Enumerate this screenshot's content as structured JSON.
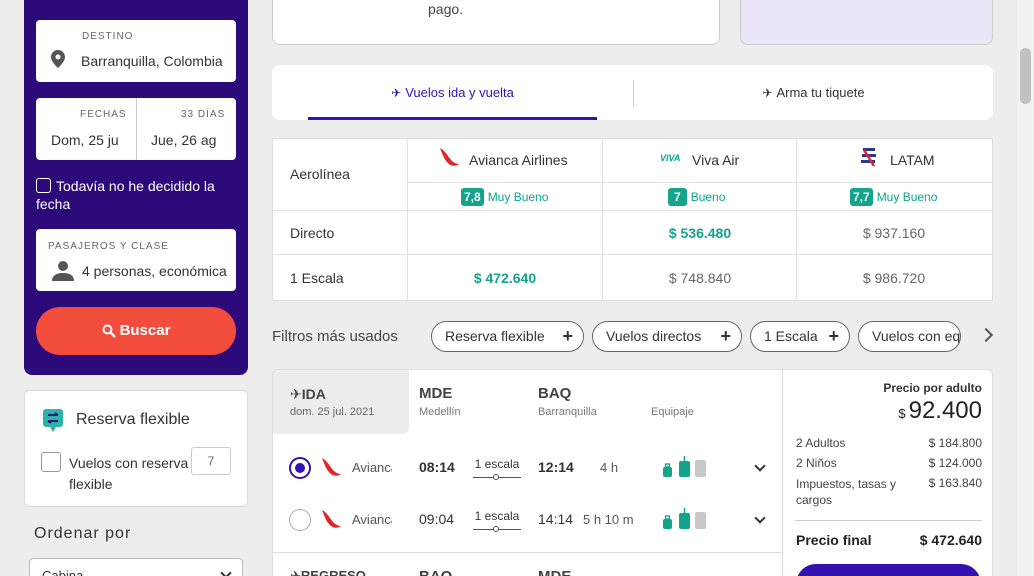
{
  "search": {
    "destination_label": "DESTINO",
    "destination_value": "Barranquilla, Colombia",
    "dates_label": "FECHAS",
    "days_label": "33 DÍAS",
    "date_from": "Dom, 25 ju",
    "date_to": "Jue, 26 ag",
    "undecided_label": "Todavía no he decidido la fecha",
    "pax_label": "PASAJEROS Y CLASE",
    "pax_value": "4 personas, económica",
    "search_button": "Buscar",
    "accent": "#2c0a7a",
    "button_color": "#f24c3d"
  },
  "flexible": {
    "title": "Reserva flexible",
    "option_label": "Vuelos con reserva flexible",
    "count": "7"
  },
  "sort": {
    "title": "Ordenar por",
    "selected": "Cabina"
  },
  "top_card": {
    "text": "pago."
  },
  "tabs": [
    {
      "label": "Vuelos ida y vuelta",
      "active": true
    },
    {
      "label": "Arma tu tiquete",
      "active": false
    }
  ],
  "matrix": {
    "airline_header": "Aerolínea",
    "airlines": [
      {
        "name": "Avianca Airlines",
        "score": "7,8",
        "rating": "Muy Bueno"
      },
      {
        "name": "Viva Air",
        "logo_text": "VIVA",
        "score": "7",
        "rating": "Bueno"
      },
      {
        "name": "LATAM",
        "score": "7,7",
        "rating": "Muy Bueno"
      }
    ],
    "rows": [
      {
        "label": "Directo",
        "prices": [
          "",
          "$ 536.480",
          "$ 937.160"
        ]
      },
      {
        "label": "1 Escala",
        "prices": [
          "$ 472.640",
          "$ 748.840",
          "$ 986.720"
        ]
      }
    ]
  },
  "filters": {
    "title": "Filtros más usados",
    "chips": [
      "Reserva flexible",
      "Vuelos directos",
      "1 Escala",
      "Vuelos con equipaje"
    ]
  },
  "result": {
    "ida": {
      "label": "IDA",
      "date": "dom. 25 jul. 2021"
    },
    "origin_code": "MDE",
    "origin_city": "Medellín",
    "dest_code": "BAQ",
    "dest_city": "Barranquilla",
    "baggage_label": "Equipaje",
    "flights": [
      {
        "airline": "Avianca",
        "dep": "08:14",
        "stops": "1 escala",
        "arr": "12:14",
        "duration": "4 h",
        "selected": true
      },
      {
        "airline": "Avianca",
        "dep": "09:04",
        "stops": "1 escala",
        "arr": "14:14",
        "duration": "5 h 10 m",
        "selected": false
      }
    ],
    "regreso": {
      "label": "REGRESO",
      "origin_code": "BAQ",
      "dest_code": "MDE"
    }
  },
  "price_box": {
    "per_adult_label": "Precio por adulto",
    "currency": "$",
    "per_adult": "92.400",
    "lines": [
      {
        "label": "2 Adultos",
        "value": "$ 184.800"
      },
      {
        "label": "2 Niños",
        "value": "$ 124.000"
      },
      {
        "label": "Impuestos, tasas y cargos",
        "value": "$ 163.840"
      }
    ],
    "final_label": "Precio final",
    "final_value": "$ 472.640"
  }
}
